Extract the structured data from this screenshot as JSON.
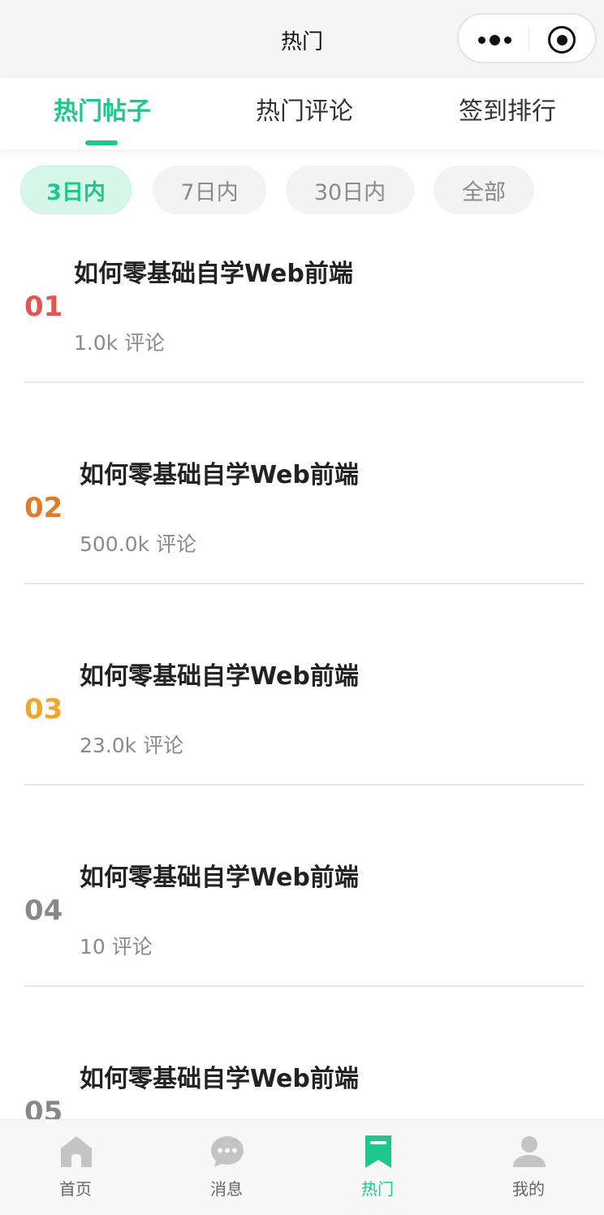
{
  "nav": {
    "title": "热门"
  },
  "tabs": [
    {
      "label": "热门帖子",
      "active": true
    },
    {
      "label": "热门评论",
      "active": false
    },
    {
      "label": "签到排行",
      "active": false
    }
  ],
  "filters": [
    {
      "label": "3日内",
      "active": true
    },
    {
      "label": "7日内",
      "active": false
    },
    {
      "label": "30日内",
      "active": false
    },
    {
      "label": "全部",
      "active": false
    }
  ],
  "posts": [
    {
      "rank": "01",
      "title": "如何零基础自学Web前端",
      "meta": "1.0k 评论",
      "rank_color": "#e5554f"
    },
    {
      "rank": "02",
      "title": "如何零基础自学Web前端",
      "meta": "500.0k 评论",
      "rank_color": "#e07b2c"
    },
    {
      "rank": "03",
      "title": "如何零基础自学Web前端",
      "meta": "23.0k 评论",
      "rank_color": "#f0a52c"
    },
    {
      "rank": "04",
      "title": "如何零基础自学Web前端",
      "meta": "10 评论",
      "rank_color": "#888888"
    },
    {
      "rank": "05",
      "title": "如何零基础自学Web前端",
      "meta": "",
      "rank_color": "#888888"
    }
  ],
  "tabbar": [
    {
      "label": "首页",
      "icon": "home-icon",
      "active": false
    },
    {
      "label": "消息",
      "icon": "message-icon",
      "active": false
    },
    {
      "label": "热门",
      "icon": "bookmark-icon",
      "active": true
    },
    {
      "label": "我的",
      "icon": "user-icon",
      "active": false
    }
  ],
  "colors": {
    "accent": "#1ec78a",
    "inactive_icon": "#c4c4c4"
  }
}
